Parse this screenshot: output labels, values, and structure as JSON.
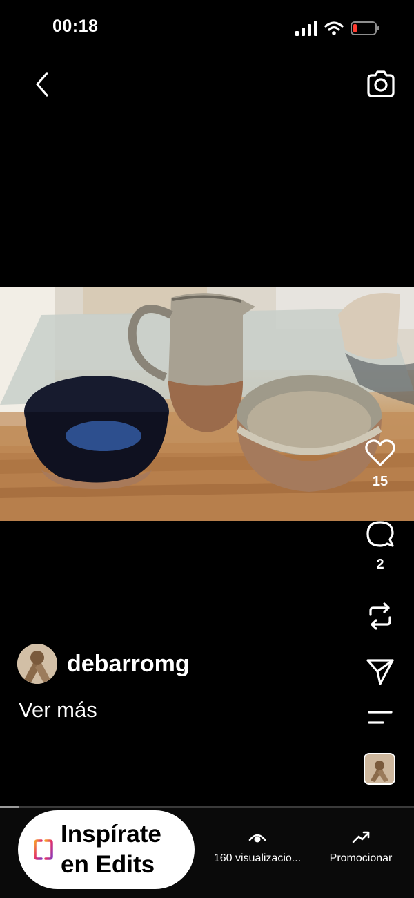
{
  "status_bar": {
    "time": "00:18",
    "icons": [
      "signal-icon",
      "wifi-icon",
      "battery-low-icon"
    ],
    "battery_color": "#ff3b30"
  },
  "header": {
    "icons": [
      "back-chevron-icon",
      "camera-icon"
    ]
  },
  "post": {
    "username": "debarromg",
    "see_more": "Ver más"
  },
  "actions": {
    "likes": "15",
    "comments": "2",
    "icons": [
      "heart-icon",
      "comment-icon",
      "repost-icon",
      "send-icon",
      "menu-icon"
    ]
  },
  "playback": {
    "progress": 0.045
  },
  "bottom_bar": {
    "edits_line1": "Inspírate",
    "edits_line2": "en Edits",
    "views_label": "160 visualizacio...",
    "promote_label": "Promocionar"
  }
}
